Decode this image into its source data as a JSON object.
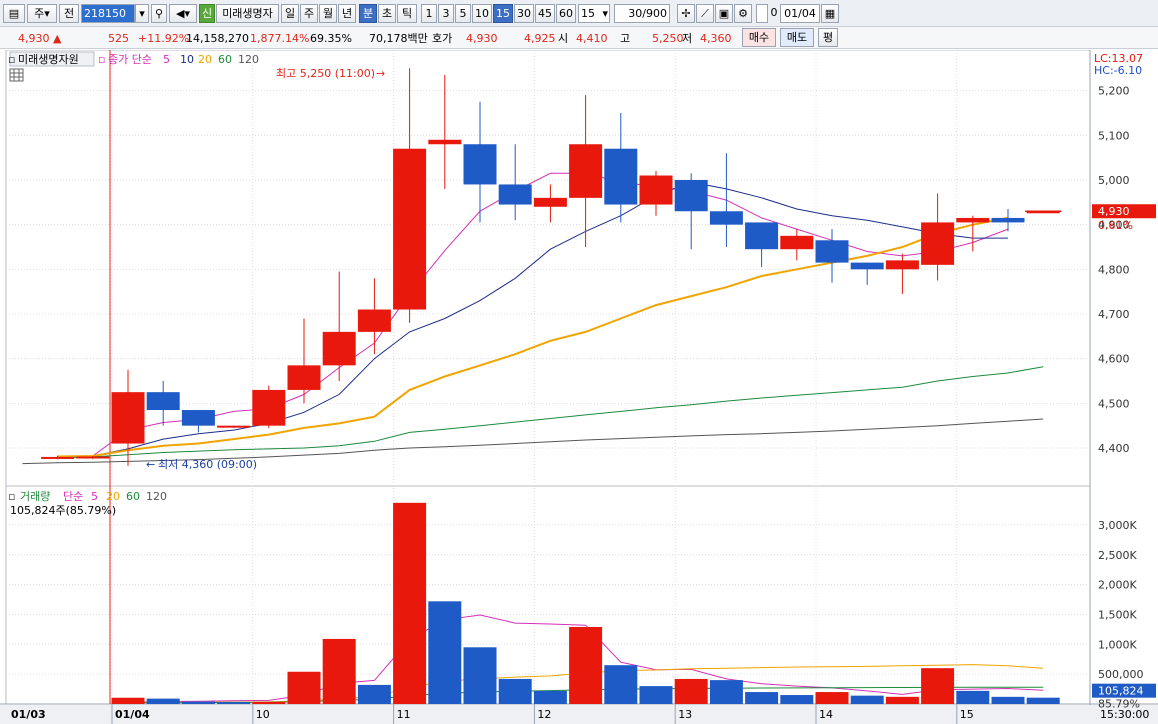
{
  "toolbar": {
    "market_type": "주",
    "market_sel": "전",
    "stock_code": "218150",
    "stock_badge": "신",
    "stock_name": "미래생명자",
    "periods": [
      "일",
      "주",
      "월",
      "년",
      "분",
      "초",
      "틱"
    ],
    "active_period": "분",
    "intervals": [
      "1",
      "3",
      "5",
      "10",
      "15",
      "30",
      "45",
      "60"
    ],
    "active_interval": "15",
    "interval_value": "15",
    "count": "30/900",
    "date": "01/04",
    "checkbox_label": "0"
  },
  "quote": {
    "price": "4,930",
    "change": "525",
    "change_pct": "+11.92%",
    "volume": "14,158,270",
    "volume_pct": "1,877.14%",
    "turnover": "69.35%",
    "amount": "70,178백만",
    "ask_label": "호가",
    "ask1": "4,930",
    "ask2": "4,925",
    "open_label": "시",
    "open": "4,410",
    "high_label": "고",
    "high": "5,250",
    "low_label": "저",
    "low": "4,360",
    "buy_label": "매수",
    "sell_label": "매도",
    "avg_label": "평"
  },
  "chart_data": [
    {
      "type": "candlestick",
      "stock_label": "미래생명자원",
      "legend_title": "종가 단순",
      "ma_periods": [
        "5",
        "10",
        "20",
        "60",
        "120"
      ],
      "lc_label": "LC:13.07",
      "hc_label": "HC:-6.10",
      "high_annotation": "최고 5,250 (11:00)",
      "low_annotation": "최저 4,360 (09:00)",
      "current_price_label": "4,930",
      "current_pct_label": "0.61%",
      "y_ticks": [
        "5,200",
        "5,100",
        "5,000",
        "4,900",
        "4,800",
        "4,700",
        "4,600",
        "4,500",
        "4,400"
      ],
      "y_tick_values": [
        5200,
        5100,
        5000,
        4900,
        4800,
        4700,
        4600,
        4500,
        4400
      ],
      "ylim": [
        4350,
        5250
      ],
      "x_labels": [
        {
          "label": "01/03",
          "index": -3.1
        },
        {
          "label": "01/04",
          "index": 0
        },
        {
          "label": "10",
          "index": 4
        },
        {
          "label": "11",
          "index": 8
        },
        {
          "label": "12",
          "index": 12
        },
        {
          "label": "13",
          "index": 16
        },
        {
          "label": "14",
          "index": 20
        },
        {
          "label": "15",
          "index": 24
        }
      ],
      "time_label": "15:30:00",
      "prev_candles": [
        {
          "o": 4380,
          "h": 4383,
          "l": 4375,
          "c": 4380
        },
        {
          "o": 4378,
          "h": 4382,
          "l": 4375,
          "c": 4381
        }
      ],
      "candles": [
        {
          "o": 4410,
          "h": 4575,
          "l": 4360,
          "c": 4525
        },
        {
          "o": 4525,
          "h": 4550,
          "l": 4450,
          "c": 4485
        },
        {
          "o": 4485,
          "h": 4485,
          "l": 4435,
          "c": 4450
        },
        {
          "o": 4450,
          "h": 4450,
          "l": 4445,
          "c": 4450
        },
        {
          "o": 4450,
          "h": 4540,
          "l": 4445,
          "c": 4530
        },
        {
          "o": 4530,
          "h": 4690,
          "l": 4500,
          "c": 4585
        },
        {
          "o": 4585,
          "h": 4795,
          "l": 4550,
          "c": 4660
        },
        {
          "o": 4660,
          "h": 4780,
          "l": 4610,
          "c": 4710
        },
        {
          "o": 4710,
          "h": 5250,
          "l": 4680,
          "c": 5070
        },
        {
          "o": 5080,
          "h": 5235,
          "l": 4980,
          "c": 5090
        },
        {
          "o": 5080,
          "h": 5175,
          "l": 4905,
          "c": 4990
        },
        {
          "o": 4990,
          "h": 5080,
          "l": 4910,
          "c": 4945
        },
        {
          "o": 4940,
          "h": 4990,
          "l": 4905,
          "c": 4960
        },
        {
          "o": 4960,
          "h": 5190,
          "l": 4850,
          "c": 5080
        },
        {
          "o": 5070,
          "h": 5150,
          "l": 4905,
          "c": 4945
        },
        {
          "o": 4945,
          "h": 5020,
          "l": 4920,
          "c": 5010
        },
        {
          "o": 5000,
          "h": 5015,
          "l": 4845,
          "c": 4930
        },
        {
          "o": 4930,
          "h": 5060,
          "l": 4850,
          "c": 4900
        },
        {
          "o": 4905,
          "h": 4905,
          "l": 4805,
          "c": 4845
        },
        {
          "o": 4845,
          "h": 4890,
          "l": 4820,
          "c": 4875
        },
        {
          "o": 4865,
          "h": 4890,
          "l": 4770,
          "c": 4815
        },
        {
          "o": 4815,
          "h": 4815,
          "l": 4765,
          "c": 4800
        },
        {
          "o": 4800,
          "h": 4835,
          "l": 4745,
          "c": 4820
        },
        {
          "o": 4810,
          "h": 4970,
          "l": 4775,
          "c": 4905
        },
        {
          "o": 4905,
          "h": 4920,
          "l": 4840,
          "c": 4915
        },
        {
          "o": 4915,
          "h": 4935,
          "l": 4885,
          "c": 4905
        },
        {
          "o": 4930,
          "h": 4930,
          "l": 4930,
          "c": 4930
        }
      ],
      "series": [
        {
          "name": "5",
          "color": "#d62fb8",
          "start": -1,
          "values": [
            4382,
            4440,
            4457,
            4464,
            4482,
            4488,
            4520,
            4580,
            4635,
            4745,
            4842,
            4930,
            4975,
            5015,
            5015,
            4995,
            4985,
            4975,
            4955,
            4915,
            4890,
            4865,
            4840,
            4830,
            4840,
            4860,
            4890
          ]
        },
        {
          "name": "10",
          "color": "#1d2c8c",
          "start": -1,
          "values": [
            4382,
            4398,
            4420,
            4432,
            4440,
            4455,
            4480,
            4520,
            4600,
            4660,
            4690,
            4730,
            4780,
            4845,
            4885,
            4920,
            4965,
            4995,
            4980,
            4960,
            4935,
            4920,
            4910,
            4895,
            4880,
            4870,
            4870
          ]
        },
        {
          "name": "20",
          "color": "#f0a400",
          "start": -2,
          "values": [
            4381,
            4382,
            4395,
            4405,
            4410,
            4420,
            4430,
            4445,
            4455,
            4470,
            4530,
            4560,
            4585,
            4610,
            4640,
            4660,
            4690,
            4720,
            4740,
            4760,
            4785,
            4800,
            4815,
            4830,
            4850,
            4880,
            4900,
            4915
          ]
        },
        {
          "name": "60",
          "color": "#1e8a3c",
          "start": -2,
          "values": [
            4378,
            4380,
            4385,
            4390,
            4393,
            4396,
            4398,
            4400,
            4405,
            4415,
            4435,
            4442,
            4450,
            4458,
            4466,
            4474,
            4482,
            4490,
            4497,
            4505,
            4512,
            4518,
            4524,
            4530,
            4536,
            4550,
            4560,
            4568,
            4582
          ]
        },
        {
          "name": "120",
          "color": "#555555",
          "start": -3,
          "values": [
            4365,
            4367,
            4368,
            4370,
            4372,
            4374,
            4377,
            4380,
            4384,
            4388,
            4395,
            4400,
            4403,
            4406,
            4410,
            4414,
            4418,
            4421,
            4424,
            4427,
            4430,
            4432,
            4435,
            4438,
            4442,
            4446,
            4450,
            4455,
            4460,
            4465
          ]
        }
      ]
    },
    {
      "type": "bar",
      "title": "거래량",
      "legend_title": "단순",
      "ma_periods": [
        "5",
        "20",
        "60",
        "120"
      ],
      "info_label": "105,824주(85.79%)",
      "current_value_label": "105,824",
      "current_pct_label": "85.79%",
      "y_ticks": [
        "3,000K",
        "2,500K",
        "2,000K",
        "1,500K",
        "1,000K",
        "500,000"
      ],
      "y_tick_values": [
        3000000,
        2500000,
        2000000,
        1500000,
        1000000,
        500000
      ],
      "ylim": [
        0,
        3440000
      ],
      "values": [
        105000,
        90000,
        40000,
        30000,
        35000,
        540000,
        1090000,
        320000,
        3370000,
        1720000,
        950000,
        420000,
        220000,
        1290000,
        650000,
        300000,
        420000,
        400000,
        200000,
        150000,
        200000,
        140000,
        120000,
        600000,
        220000,
        120000,
        105824
      ],
      "up": [
        1,
        0,
        0,
        0,
        1,
        1,
        1,
        0,
        1,
        0,
        0,
        0,
        0,
        1,
        0,
        0,
        1,
        0,
        0,
        0,
        1,
        0,
        1,
        1,
        0,
        0,
        0
      ],
      "series": [
        {
          "name": "5",
          "color": "#d62fb8",
          "start": 0,
          "values": [
            30000,
            40000,
            45000,
            55000,
            60000,
            145000,
            345000,
            395000,
            1075000,
            1410000,
            1490000,
            1355000,
            1340000,
            1320000,
            700000,
            575000,
            580000,
            420000,
            340000,
            300000,
            270000,
            220000,
            160000,
            240000,
            250000,
            260000,
            230000
          ]
        },
        {
          "name": "20",
          "color": "#f0a400",
          "start": 0,
          "values": [
            25000,
            27000,
            30000,
            32000,
            35000,
            50000,
            90000,
            120000,
            280000,
            380000,
            420000,
            450000,
            470000,
            520000,
            560000,
            570000,
            590000,
            600000,
            610000,
            620000,
            625000,
            630000,
            640000,
            650000,
            660000,
            640000,
            600000
          ]
        },
        {
          "name": "60",
          "color": "#1e8a3c",
          "start": 0,
          "values": [
            20000,
            22000,
            24000,
            26000,
            28000,
            40000,
            60000,
            80000,
            140000,
            180000,
            200000,
            215000,
            225000,
            240000,
            250000,
            255000,
            260000,
            265000,
            268000,
            270000,
            272000,
            274000,
            276000,
            278000,
            280000,
            280000,
            280000
          ]
        }
      ]
    }
  ]
}
